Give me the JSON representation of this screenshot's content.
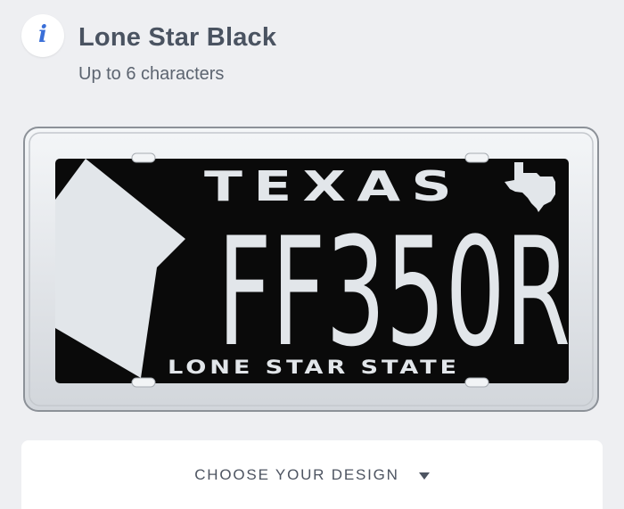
{
  "header": {
    "info_icon": "info-icon",
    "info_glyph": "i",
    "title": "Lone Star Black",
    "subtitle": "Up to 6 characters"
  },
  "plate": {
    "state": "TEXAS",
    "number": "FF350R",
    "slogan": "LONE STAR STATE",
    "emblems": [
      "star-icon",
      "texas-map-icon"
    ],
    "colors": {
      "background": "#0a0a0a",
      "frame": "#e6e9ed",
      "text": "#e2e6ea"
    }
  },
  "design_selector": {
    "label": "CHOOSE YOUR DESIGN",
    "icon": "caret-down-icon"
  },
  "colors": {
    "page_background": "#eeeff2",
    "accent": "#3a6fd8",
    "title_text": "#4a5361"
  }
}
